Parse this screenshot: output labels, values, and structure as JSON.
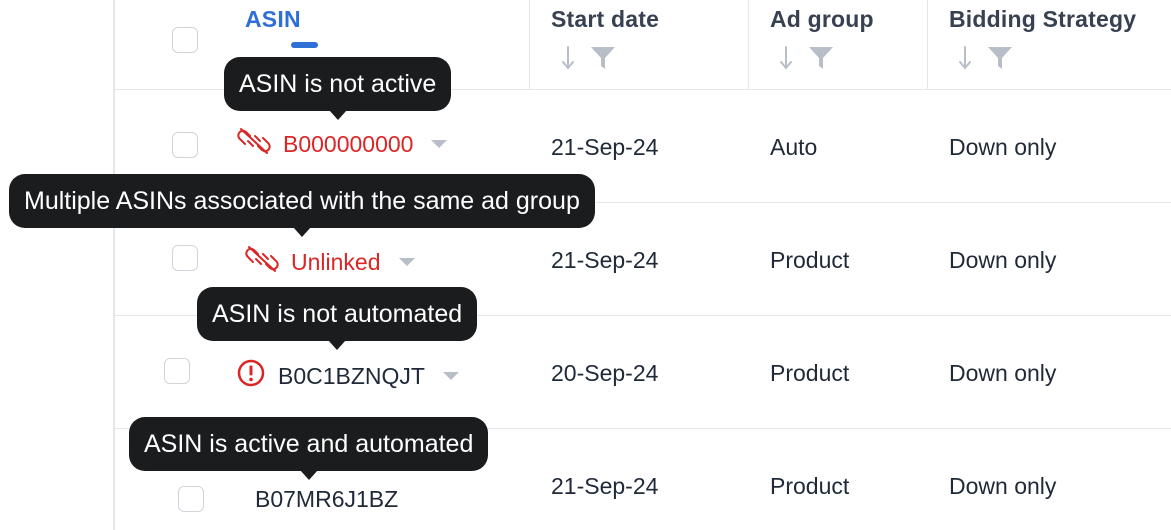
{
  "colors": {
    "accent": "#2f6fd6",
    "error": "#dc2626",
    "tooltip_bg": "#1b1c1e",
    "header_text": "#374151",
    "divider": "#e5e7eb"
  },
  "table": {
    "columns": [
      {
        "label": "ASIN",
        "active": true
      },
      {
        "label": "Start date",
        "active": false
      },
      {
        "label": "Ad group",
        "active": false
      },
      {
        "label": "Bidding Strategy",
        "active": false
      }
    ],
    "rows": [
      {
        "asin": "B000000000",
        "status_icon": "unlinked-icon",
        "asin_color": "red",
        "start_date": "21-Sep-24",
        "ad_group": "Auto",
        "bidding_strategy": "Down only"
      },
      {
        "asin": "Unlinked",
        "status_icon": "unlinked-icon",
        "asin_color": "red",
        "start_date": "21-Sep-24",
        "ad_group": "Product",
        "bidding_strategy": "Down only"
      },
      {
        "asin": "B0C1BZNQJT",
        "status_icon": "alert-circle-icon",
        "asin_color": "dark",
        "start_date": "20-Sep-24",
        "ad_group": "Product",
        "bidding_strategy": "Down only"
      },
      {
        "asin": "B07MR6J1BZ",
        "status_icon": "",
        "asin_color": "dark",
        "start_date": "21-Sep-24",
        "ad_group": "Product",
        "bidding_strategy": "Down only"
      }
    ]
  },
  "tooltips": [
    {
      "text": "ASIN is not active"
    },
    {
      "text": "Multiple ASINs associated with the same ad group"
    },
    {
      "text": "ASIN is not automated"
    },
    {
      "text": "ASIN is active and automated"
    }
  ]
}
